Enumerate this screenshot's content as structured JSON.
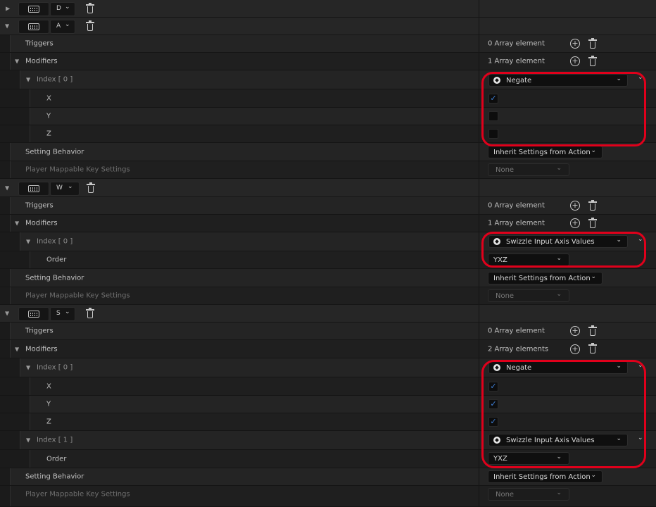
{
  "icons": {
    "expand": "▶",
    "collapse": "▼",
    "chevron": "⌄",
    "plus": "+",
    "check": "✓",
    "class_icon": "ue-class-icon",
    "keyboard": "keyboard-icon",
    "trash": "trash-icon"
  },
  "colors": {
    "highlight": "#e0001b",
    "checkbox_check": "#3e7fd6"
  },
  "mappings": [
    {
      "key": "D"
    },
    {
      "key": "A",
      "triggers": {
        "label": "Triggers",
        "count": "0 Array element"
      },
      "modifiers": {
        "label": "Modifiers",
        "count": "1 Array element"
      },
      "index0": {
        "label": "Index [ 0 ]",
        "class": "Negate",
        "x": "X",
        "y": "Y",
        "z": "Z"
      },
      "setting": {
        "label": "Setting Behavior",
        "value": "Inherit Settings from Action"
      },
      "player": {
        "label": "Player Mappable Key Settings",
        "value": "None"
      }
    },
    {
      "key": "W",
      "triggers": {
        "label": "Triggers",
        "count": "0 Array element"
      },
      "modifiers": {
        "label": "Modifiers",
        "count": "1 Array element"
      },
      "index0": {
        "label": "Index [ 0 ]",
        "class": "Swizzle Input Axis Values",
        "order_label": "Order",
        "order": "YXZ"
      },
      "setting": {
        "label": "Setting Behavior",
        "value": "Inherit Settings from Action"
      },
      "player": {
        "label": "Player Mappable Key Settings",
        "value": "None"
      }
    },
    {
      "key": "S",
      "triggers": {
        "label": "Triggers",
        "count": "0 Array element"
      },
      "modifiers": {
        "label": "Modifiers",
        "count": "2 Array elements"
      },
      "index0": {
        "label": "Index [ 0 ]",
        "class": "Negate",
        "x": "X",
        "y": "Y",
        "z": "Z"
      },
      "index1": {
        "label": "Index [ 1 ]",
        "class": "Swizzle Input Axis Values",
        "order_label": "Order",
        "order": "YXZ"
      },
      "setting": {
        "label": "Setting Behavior",
        "value": "Inherit Settings from Action"
      },
      "player": {
        "label": "Player Mappable Key Settings",
        "value": "None"
      }
    }
  ],
  "checkbox_states": {
    "A": {
      "x": true,
      "y": false,
      "z": false
    },
    "S": {
      "x": true,
      "y": true,
      "z": true
    }
  }
}
